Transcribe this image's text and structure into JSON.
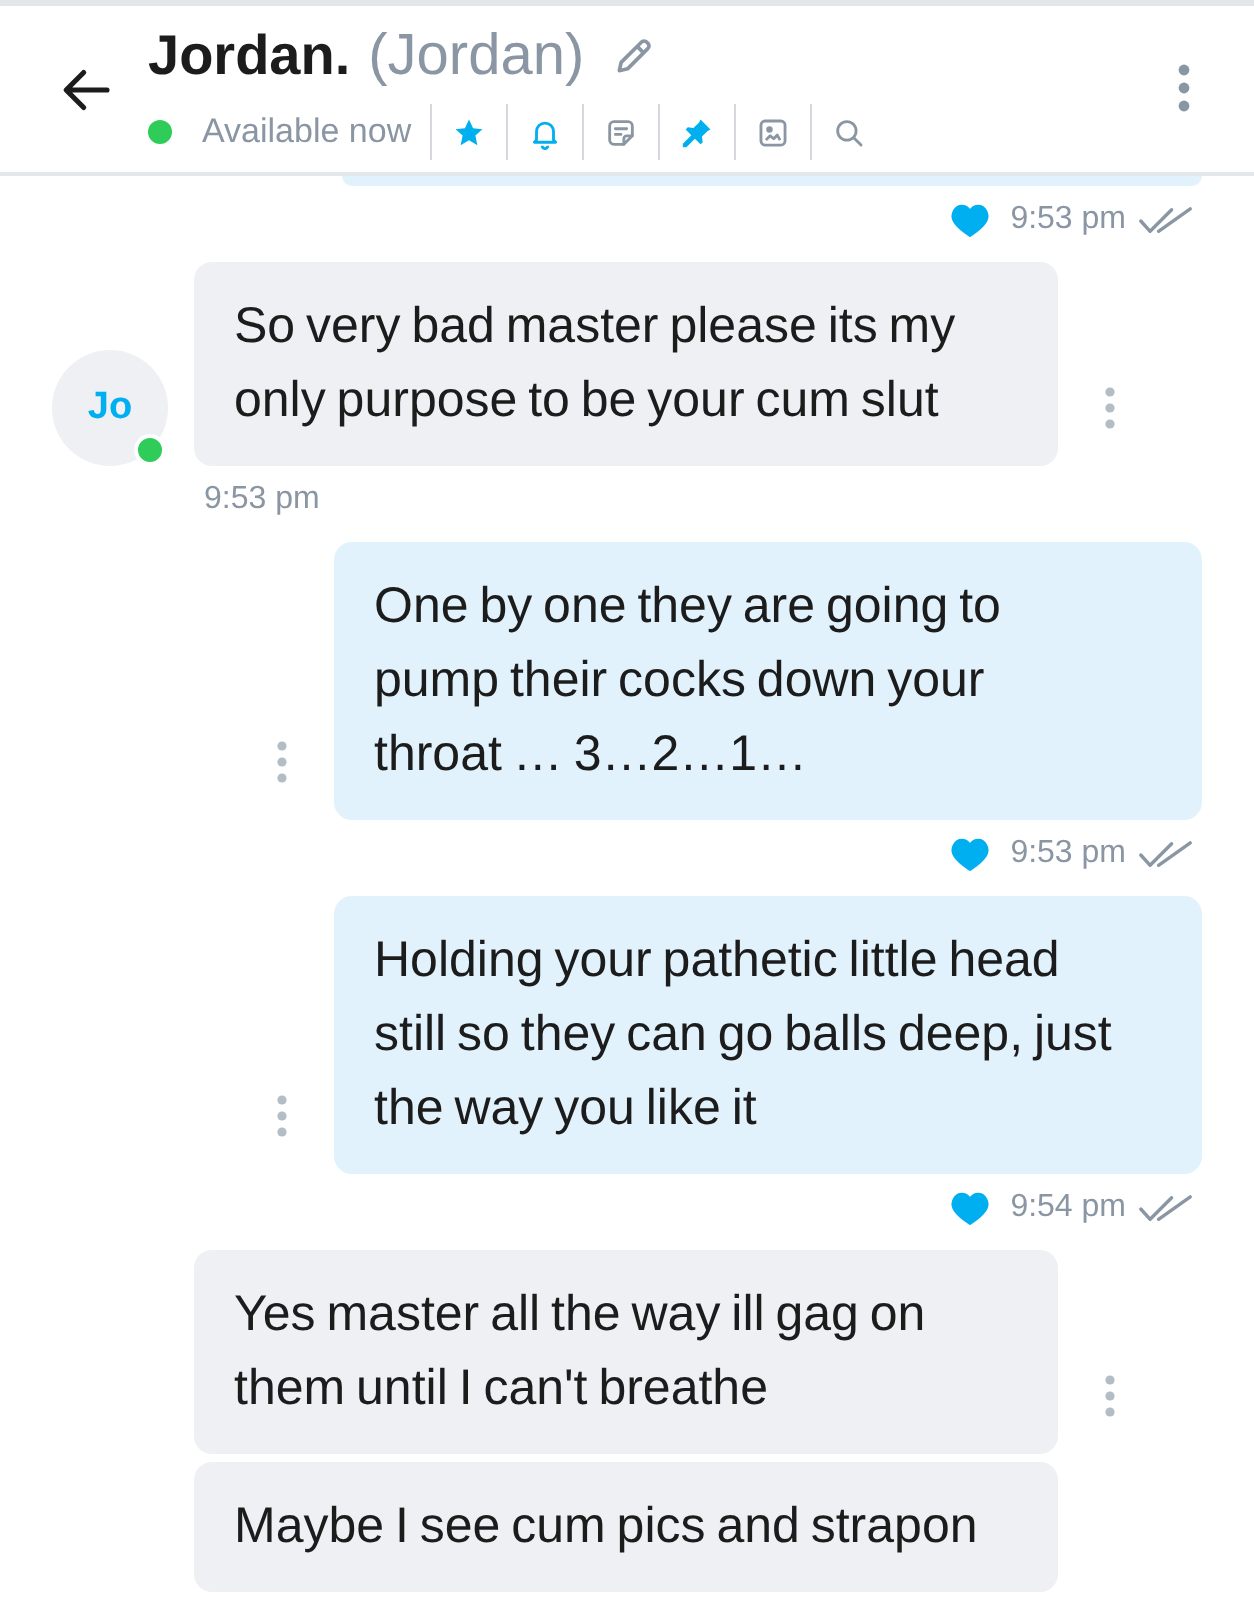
{
  "header": {
    "name": "Jordan.",
    "username": "(Jordan)",
    "online": true,
    "status": "Available now",
    "toolbar": [
      {
        "kind": "star",
        "on": true
      },
      {
        "kind": "bell",
        "on": true
      },
      {
        "kind": "note",
        "on": false
      },
      {
        "kind": "pin",
        "on": true
      },
      {
        "kind": "image",
        "on": false
      },
      {
        "kind": "search",
        "on": false
      }
    ]
  },
  "messages": [
    {
      "kind": "outgoing-tail",
      "menu": false,
      "liked": true,
      "time": "9:53 pm",
      "read": true
    },
    {
      "kind": "incoming",
      "menu": true,
      "text": "So very bad master please its my only purpose to be your cum slut",
      "avatar": {
        "initials": "Jo",
        "online": true
      },
      "time": "9:53 pm"
    },
    {
      "kind": "outgoing",
      "menu": true,
      "text": "One by one they are going to pump their cocks down your throat … 3…2…1…",
      "liked": true,
      "time": "9:53 pm",
      "read": true
    },
    {
      "kind": "outgoing",
      "menu": true,
      "text": "Holding your pathetic little head still so they can go balls deep, just the way you like it",
      "liked": true,
      "time": "9:54 pm",
      "read": true
    },
    {
      "kind": "incoming",
      "menu": true,
      "text": "Yes master all the way ill gag on them until I can't breathe"
    },
    {
      "kind": "incoming",
      "menu": false,
      "text": "Maybe I see cum pics and strapon"
    }
  ]
}
